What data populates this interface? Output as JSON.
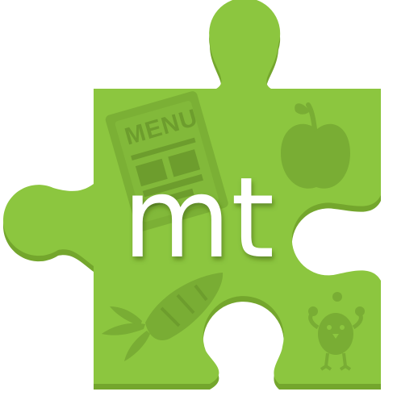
{
  "logo": {
    "text": "mt",
    "menu_text": "MENU",
    "brand_color": "#8cc63f",
    "edge_color": "#74a62d",
    "icon_color": "#79ad34"
  },
  "icons": [
    "puzzle-piece-icon",
    "menu-card-icon",
    "apple-icon",
    "carrot-icon",
    "juggling-chick-icon"
  ]
}
